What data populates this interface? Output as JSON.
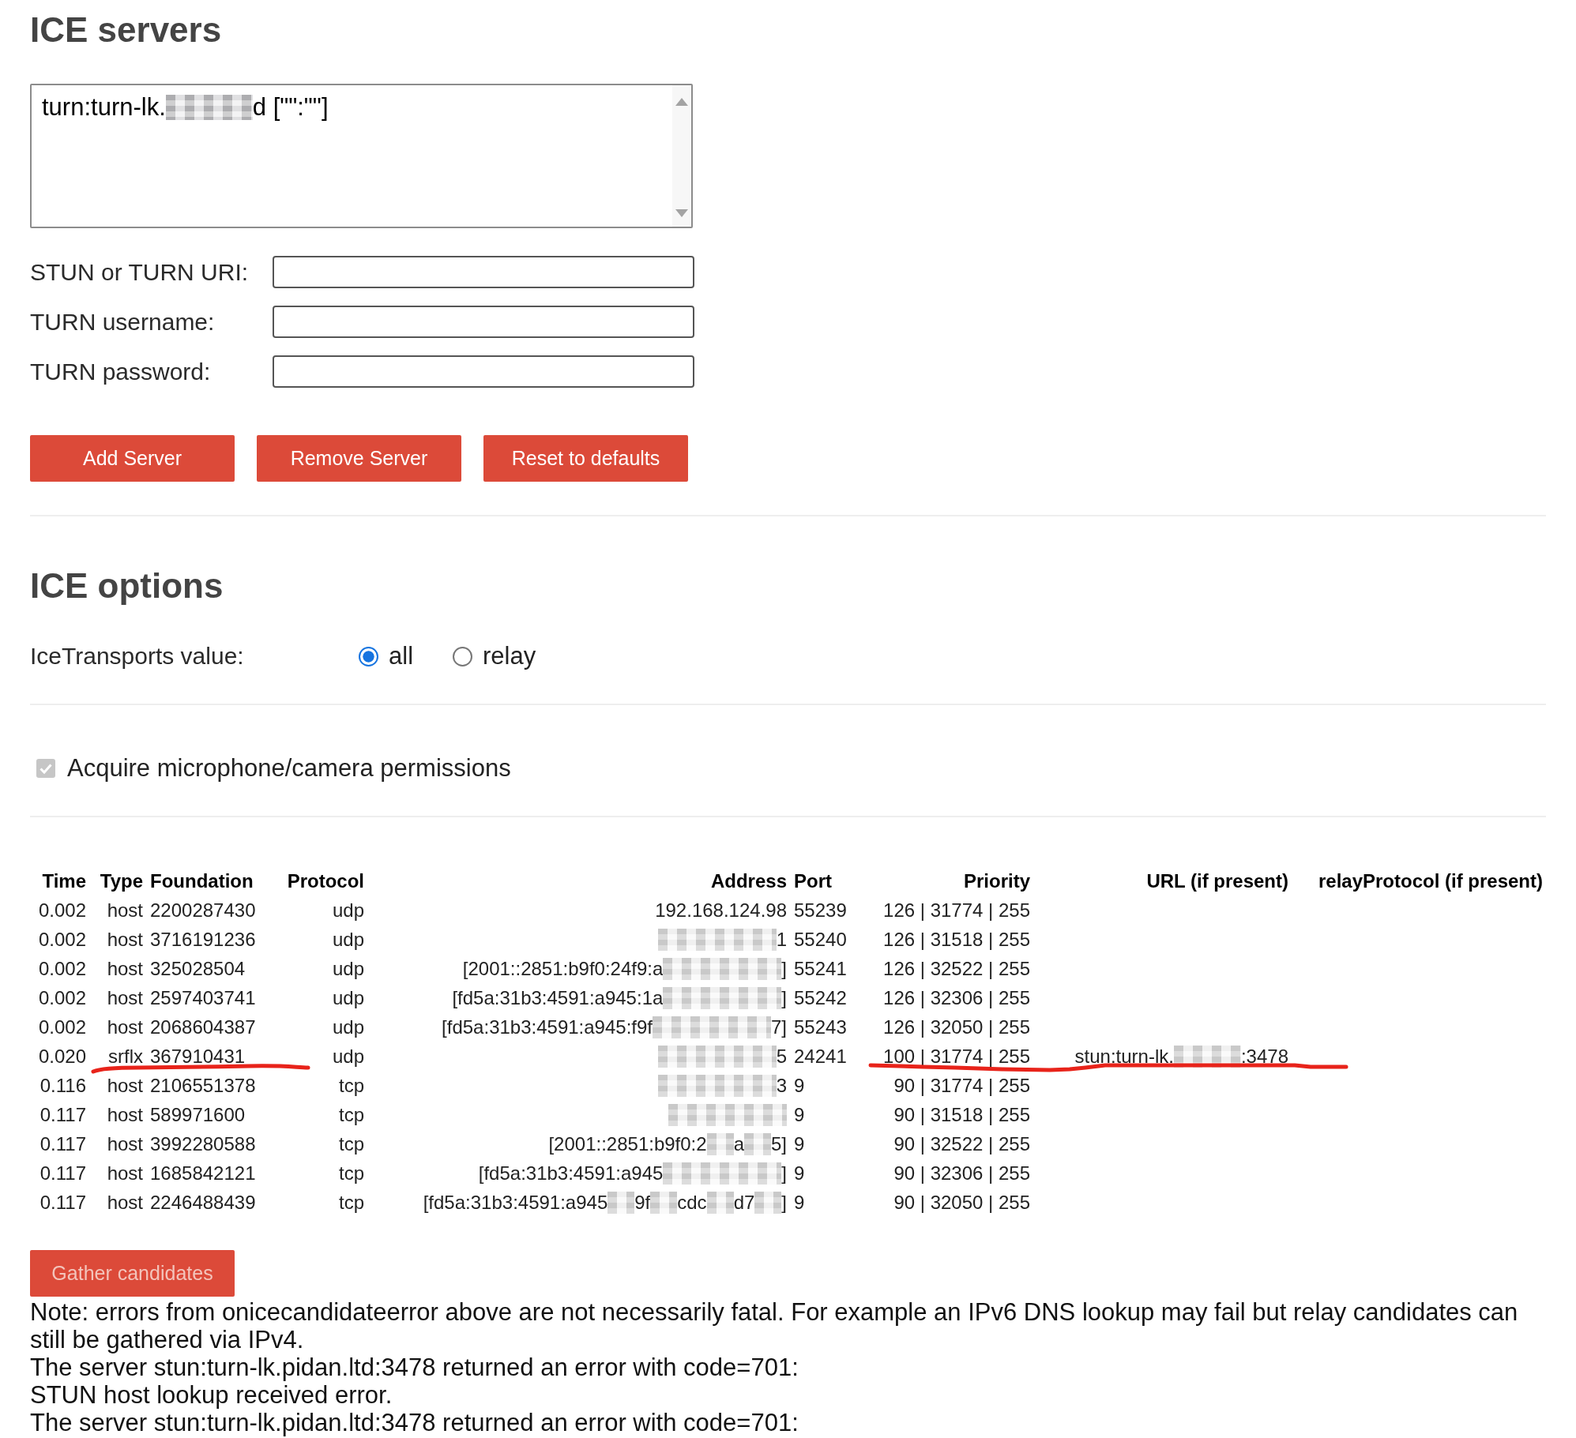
{
  "ice_servers": {
    "title": "ICE servers",
    "server_list": {
      "entries": [
        {
          "segments": [
            {
              "kind": "text",
              "text": "turn:turn-lk."
            },
            {
              "kind": "redacted"
            },
            {
              "kind": "text",
              "text": "d [\"\":\"\"]"
            }
          ]
        }
      ]
    },
    "fields": [
      {
        "label": "STUN or TURN URI:"
      },
      {
        "label": "TURN username:"
      },
      {
        "label": "TURN password:"
      }
    ],
    "buttons": [
      {
        "label": "Add Server",
        "disabled": false
      },
      {
        "label": "Remove Server",
        "disabled": false
      },
      {
        "label": "Reset to defaults",
        "disabled": false
      }
    ]
  },
  "ice_options": {
    "title": "ICE options",
    "transports": {
      "label": "IceTransports value:",
      "options": [
        {
          "label": "all",
          "selected": true
        },
        {
          "label": "relay",
          "selected": false
        }
      ]
    }
  },
  "permissions": {
    "label": "Acquire microphone/camera permissions",
    "checked": true,
    "disabled": true
  },
  "candidates_table": {
    "columns": [
      "Time",
      "Type",
      "Foundation",
      "Protocol",
      "Address",
      "Port",
      "Priority",
      "URL (if present)",
      "relayProtocol (if present)"
    ],
    "rows": [
      {
        "time": "0.002",
        "type": "host",
        "foundation": "2200287430",
        "protocol": "udp",
        "address": [
          {
            "kind": "text",
            "text": "192.168.124.98"
          }
        ],
        "port": "55239",
        "priority": "126 | 31774 | 255",
        "underlined": false
      },
      {
        "time": "0.002",
        "type": "host",
        "foundation": "3716191236",
        "protocol": "udp",
        "address": [
          {
            "kind": "redacted"
          },
          {
            "kind": "text",
            "text": "1"
          }
        ],
        "port": "55240",
        "priority": "126 | 31518 | 255",
        "underlined": false
      },
      {
        "time": "0.002",
        "type": "host",
        "foundation": "325028504",
        "protocol": "udp",
        "address": [
          {
            "kind": "text",
            "text": "[2001::2851:b9f0:24f9:a"
          },
          {
            "kind": "redacted"
          },
          {
            "kind": "text",
            "text": "]"
          }
        ],
        "port": "55241",
        "priority": "126 | 32522 | 255",
        "underlined": false
      },
      {
        "time": "0.002",
        "type": "host",
        "foundation": "2597403741",
        "protocol": "udp",
        "address": [
          {
            "kind": "text",
            "text": "[fd5a:31b3:4591:a945:1a"
          },
          {
            "kind": "redacted"
          },
          {
            "kind": "text",
            "text": "]"
          }
        ],
        "port": "55242",
        "priority": "126 | 32306 | 255",
        "underlined": false
      },
      {
        "time": "0.002",
        "type": "host",
        "foundation": "2068604387",
        "protocol": "udp",
        "address": [
          {
            "kind": "text",
            "text": "[fd5a:31b3:4591:a945:f9f"
          },
          {
            "kind": "redacted"
          },
          {
            "kind": "text",
            "text": "7]"
          }
        ],
        "port": "55243",
        "priority": "126 | 32050 | 255",
        "underlined": false
      },
      {
        "time": "0.020",
        "type": "srflx",
        "foundation": "367910431",
        "protocol": "udp",
        "address": [
          {
            "kind": "redacted"
          },
          {
            "kind": "text",
            "text": "5"
          }
        ],
        "port": "24241",
        "priority": "100 | 31774 | 255",
        "url": [
          {
            "kind": "text",
            "text": "stun:turn-lk."
          },
          {
            "kind": "redacted"
          },
          {
            "kind": "text",
            "text": ":3478"
          }
        ],
        "underlined": true
      },
      {
        "time": "0.116",
        "type": "host",
        "foundation": "2106551378",
        "protocol": "tcp",
        "address": [
          {
            "kind": "redacted"
          },
          {
            "kind": "text",
            "text": "3"
          }
        ],
        "port": "9",
        "priority": "90 | 31774 | 255",
        "underlined": false
      },
      {
        "time": "0.117",
        "type": "host",
        "foundation": "589971600",
        "protocol": "tcp",
        "address": [
          {
            "kind": "redacted"
          }
        ],
        "port": "9",
        "priority": "90 | 31518 | 255",
        "underlined": false
      },
      {
        "time": "0.117",
        "type": "host",
        "foundation": "3992280588",
        "protocol": "tcp",
        "address": [
          {
            "kind": "text",
            "text": "[2001::2851:b9f0:2"
          },
          {
            "kind": "redacted"
          },
          {
            "kind": "text",
            "text": "a"
          },
          {
            "kind": "redacted"
          },
          {
            "kind": "text",
            "text": "5]"
          }
        ],
        "port": "9",
        "priority": "90 | 32522 | 255",
        "underlined": false
      },
      {
        "time": "0.117",
        "type": "host",
        "foundation": "1685842121",
        "protocol": "tcp",
        "address": [
          {
            "kind": "text",
            "text": "[fd5a:31b3:4591:a945"
          },
          {
            "kind": "redacted"
          },
          {
            "kind": "text",
            "text": "]"
          }
        ],
        "port": "9",
        "priority": "90 | 32306 | 255",
        "underlined": false
      },
      {
        "time": "0.117",
        "type": "host",
        "foundation": "2246488439",
        "protocol": "tcp",
        "address": [
          {
            "kind": "text",
            "text": "[fd5a:31b3:4591:a945"
          },
          {
            "kind": "redacted"
          },
          {
            "kind": "text",
            "text": "9f"
          },
          {
            "kind": "redacted"
          },
          {
            "kind": "text",
            "text": "cdc"
          },
          {
            "kind": "redacted"
          },
          {
            "kind": "text",
            "text": "d7"
          },
          {
            "kind": "redacted"
          },
          {
            "kind": "text",
            "text": "]"
          }
        ],
        "port": "9",
        "priority": "90 | 32050 | 255",
        "underlined": false
      }
    ]
  },
  "gather_button": {
    "label": "Gather candidates",
    "disabled": true
  },
  "messages": [
    "Note: errors from onicecandidateerror above are not necessarily fatal. For example an IPv6 DNS lookup may fail but relay candidates can still be gathered via IPv4.",
    "The server stun:turn-lk.pidan.ltd:3478 returned an error with code=701:",
    "STUN host lookup received error.",
    "The server stun:turn-lk.pidan.ltd:3478 returned an error with code=701:"
  ]
}
